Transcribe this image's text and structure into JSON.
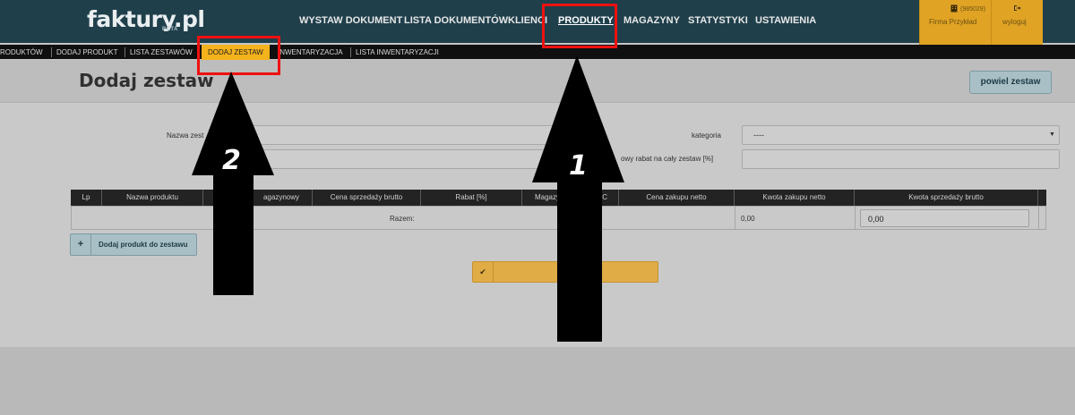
{
  "header": {
    "logo": "faktury.pl",
    "logo_badge": "BETA",
    "nav": [
      {
        "label": "WYSTAW DOKUMENT",
        "active": false
      },
      {
        "label": "LISTA DOKUMENTÓW",
        "active": false
      },
      {
        "label": "KLIENCI",
        "active": false
      },
      {
        "label": "PRODUKTY",
        "active": true
      },
      {
        "label": "MAGAZYNY",
        "active": false
      },
      {
        "label": "STATYSTYKI",
        "active": false
      },
      {
        "label": "USTAWIENIA",
        "active": false
      }
    ],
    "company_id": "(985029)",
    "company_name": "Firma Przykład",
    "logout_label": "wyloguj",
    "company_icon": "building-icon",
    "logout_icon": "sign-out-icon"
  },
  "subnav": {
    "items": [
      {
        "label": "RODUKTÓW",
        "active": false
      },
      {
        "label": "DODAJ PRODUKT",
        "active": false
      },
      {
        "label": "LISTA ZESTAWÓW",
        "active": false
      },
      {
        "label": "DODAJ ZESTAW",
        "active": true
      },
      {
        "label": "INWENTARYZACJA",
        "active": false
      },
      {
        "label": "LISTA INWENTARYZACJI",
        "active": false
      }
    ]
  },
  "page": {
    "title": "Dodaj zestaw",
    "copy_button": "powiel zestaw"
  },
  "form": {
    "name_label": "Nazwa zest",
    "category_label": "kategoria",
    "category_value": "----",
    "discount_label": "owy rabat na cały zestaw [%]",
    "name_value": "",
    "discount_value": ""
  },
  "table": {
    "headers": [
      "Lp",
      "Nazwa produktu",
      "agazynowy",
      "Cena sprzedaży brutto",
      "Rabat [%]",
      "Magazy",
      "C",
      "Cena zakupu netto",
      "Kwota zakupu netto",
      "Kwota sprzedaży brutto",
      ""
    ],
    "total_label": "Razem:",
    "purchase_total": "0,00",
    "sales_total": "0,00"
  },
  "actions": {
    "add_product_label": "Dodaj produkt do zestawu",
    "add_icon": "plus-icon",
    "save_icon": "check-icon"
  },
  "annotations": {
    "arrow_1_label": "1",
    "arrow_2_label": "2",
    "highlight_color": "#ef1111",
    "arrow_color": "#000000"
  },
  "colors": {
    "topbar": "#1f3f4b",
    "accent_yellow": "#f4b21c",
    "button_blue": "#a9bfc6",
    "save_gold": "#dfac45"
  }
}
